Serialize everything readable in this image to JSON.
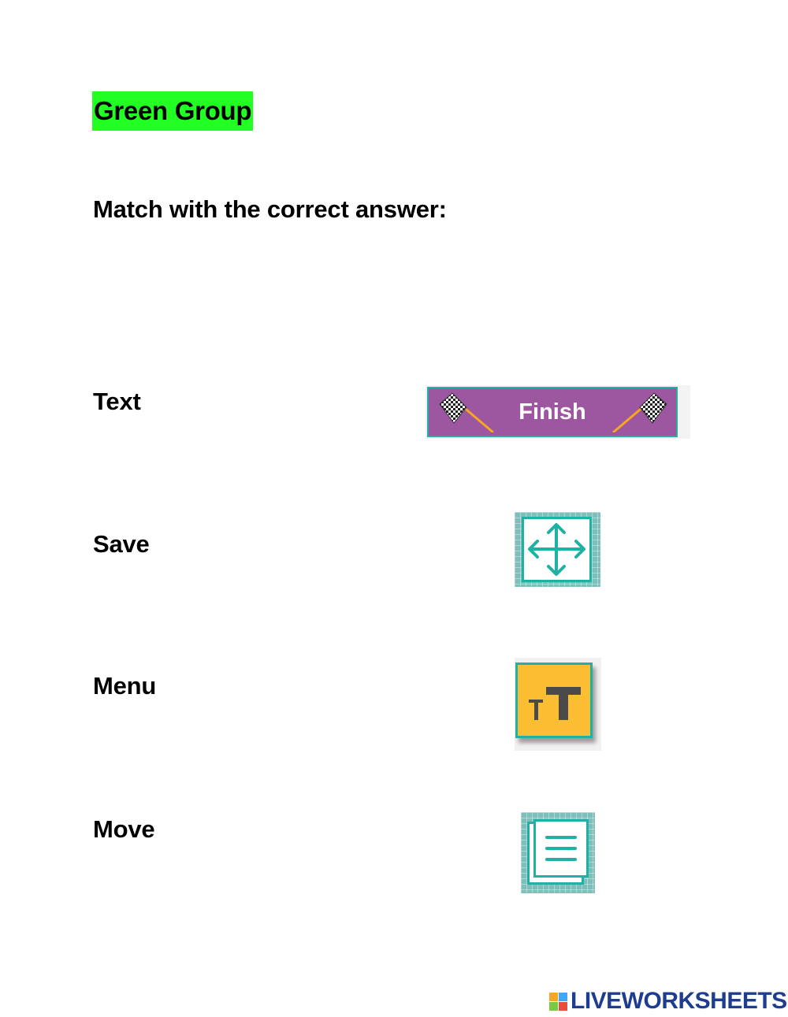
{
  "header": {
    "group_title": "Green Group",
    "instructions": "Match with the correct answer:"
  },
  "words": [
    "Text",
    "Save",
    "Menu",
    "Move"
  ],
  "images": {
    "finish_label": "Finish"
  },
  "icons": {
    "finish": "finish-banner-icon",
    "move": "move-arrows-icon",
    "text": "text-size-icon",
    "menu": "menu-lines-icon"
  },
  "footer": {
    "logo_text": "LIVEWORKSHEETS"
  },
  "colors": {
    "highlight": "#22ff22",
    "teal": "#1fb1a3",
    "purple": "#9d57a1",
    "yellow": "#fbbe33",
    "logo": "#1e3d8f"
  }
}
